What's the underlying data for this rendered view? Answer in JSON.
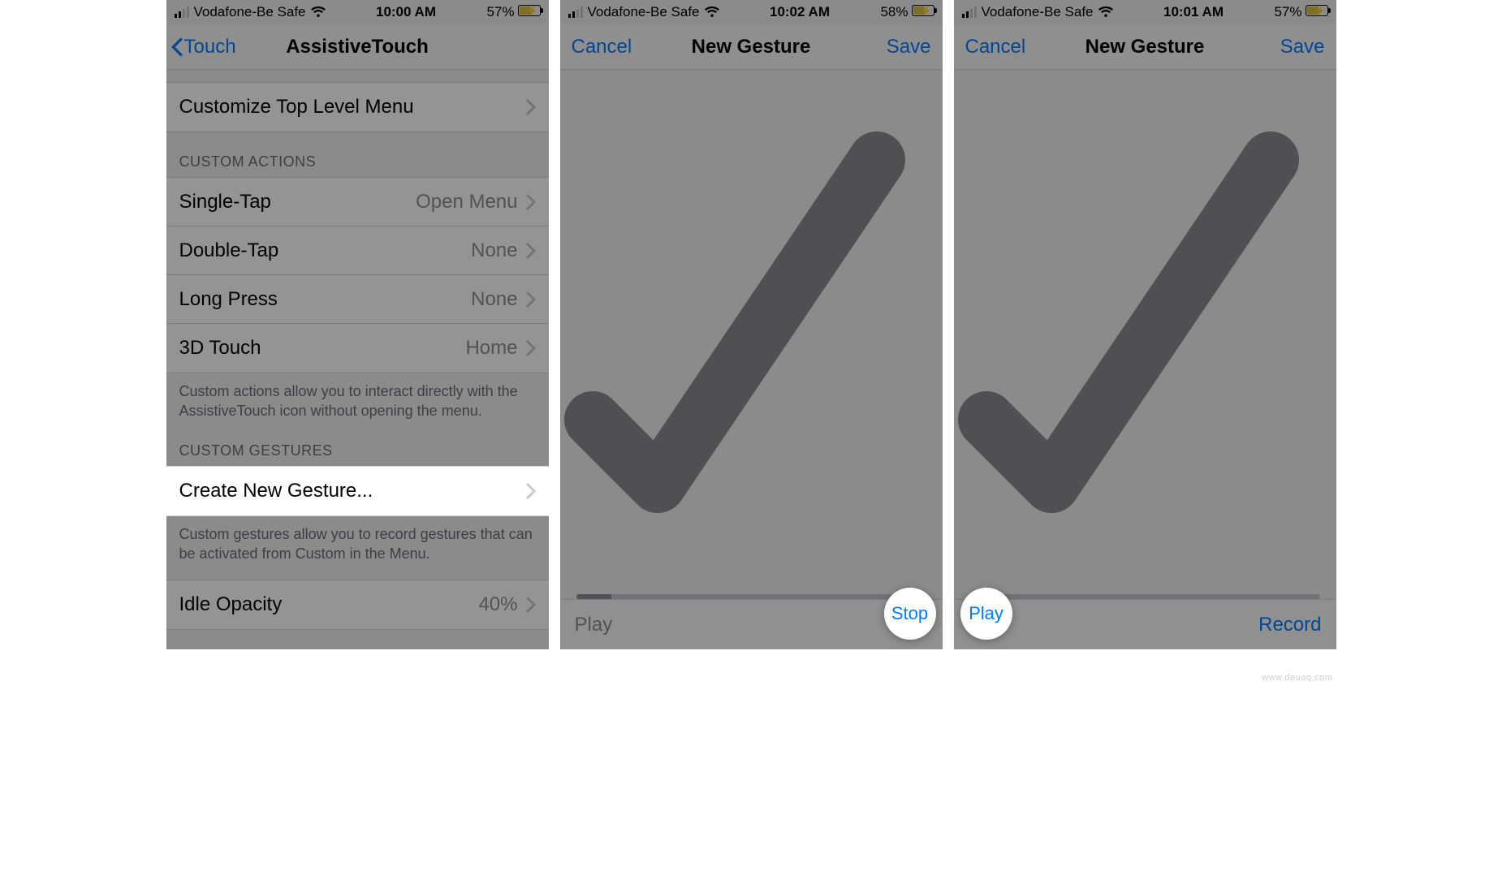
{
  "screen1": {
    "status": {
      "carrier": "Vodafone-Be Safe",
      "time": "10:00 AM",
      "battery": "57%"
    },
    "nav": {
      "back": "Touch",
      "title": "AssistiveTouch"
    },
    "top_menu": {
      "customize": "Customize Top Level Menu"
    },
    "custom_actions_header": "CUSTOM ACTIONS",
    "actions": {
      "single_tap": {
        "label": "Single-Tap",
        "value": "Open Menu"
      },
      "double_tap": {
        "label": "Double-Tap",
        "value": "None"
      },
      "long_press": {
        "label": "Long Press",
        "value": "None"
      },
      "three_d": {
        "label": "3D Touch",
        "value": "Home"
      }
    },
    "actions_footer": "Custom actions allow you to interact directly with the AssistiveTouch icon without opening the menu.",
    "custom_gestures_header": "CUSTOM GESTURES",
    "create_gesture": "Create New Gesture...",
    "gestures_footer": "Custom gestures allow you to record gestures that can be activated from Custom in the Menu.",
    "idle_opacity": {
      "label": "Idle Opacity",
      "value": "40%"
    }
  },
  "screen2": {
    "status": {
      "carrier": "Vodafone-Be Safe",
      "time": "10:02 AM",
      "battery": "58%"
    },
    "nav": {
      "cancel": "Cancel",
      "title": "New Gesture",
      "save": "Save"
    },
    "bottom": {
      "left": "Play",
      "right": "Stop"
    },
    "fab": "Stop"
  },
  "screen3": {
    "status": {
      "carrier": "Vodafone-Be Safe",
      "time": "10:01 AM",
      "battery": "57%"
    },
    "nav": {
      "cancel": "Cancel",
      "title": "New Gesture",
      "save": "Save"
    },
    "bottom": {
      "left": "Play",
      "right": "Record"
    },
    "fab": "Play"
  },
  "watermark": "www.deuaq.com"
}
